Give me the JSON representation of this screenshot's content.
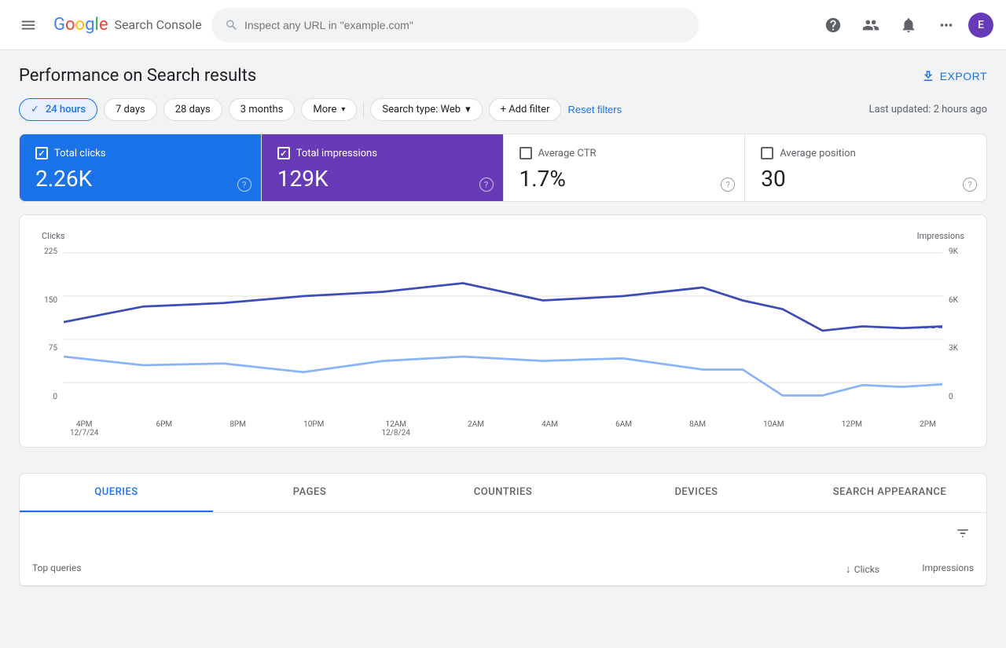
{
  "header": {
    "menu_icon": "menu",
    "logo": {
      "google": "Google",
      "product": "Search Console"
    },
    "search_placeholder": "Inspect any URL in \"example.com\"",
    "icons": [
      "help",
      "people",
      "bell",
      "grid"
    ],
    "avatar_letter": "E"
  },
  "page": {
    "title": "Performance on Search results",
    "export_label": "EXPORT"
  },
  "filters": {
    "time_filters": [
      {
        "label": "24 hours",
        "active": true
      },
      {
        "label": "7 days",
        "active": false
      },
      {
        "label": "28 days",
        "active": false
      },
      {
        "label": "3 months",
        "active": false
      },
      {
        "label": "More",
        "active": false,
        "has_arrow": true
      }
    ],
    "search_type": "Search type: Web",
    "add_filter": "+ Add filter",
    "reset": "Reset filters",
    "last_updated": "Last updated: 2 hours ago"
  },
  "metrics": [
    {
      "id": "total-clicks",
      "label": "Total clicks",
      "value": "2.26K",
      "checked": true,
      "style": "active-blue"
    },
    {
      "id": "total-impressions",
      "label": "Total impressions",
      "value": "129K",
      "checked": true,
      "style": "active-purple"
    },
    {
      "id": "avg-ctr",
      "label": "Average CTR",
      "value": "1.7%",
      "checked": false,
      "style": ""
    },
    {
      "id": "avg-position",
      "label": "Average position",
      "value": "30",
      "checked": false,
      "style": ""
    }
  ],
  "chart": {
    "y_label_left": "Clicks",
    "y_label_right": "Impressions",
    "y_ticks_left": [
      "225",
      "150",
      "75",
      "0"
    ],
    "y_ticks_right": [
      "9K",
      "6K",
      "3K",
      "0"
    ],
    "x_labels": [
      {
        "main": "4PM",
        "sub": "12/7/24"
      },
      {
        "main": "6PM",
        "sub": ""
      },
      {
        "main": "8PM",
        "sub": ""
      },
      {
        "main": "10PM",
        "sub": ""
      },
      {
        "main": "12AM",
        "sub": "12/8/24"
      },
      {
        "main": "2AM",
        "sub": ""
      },
      {
        "main": "4AM",
        "sub": ""
      },
      {
        "main": "6AM",
        "sub": ""
      },
      {
        "main": "8AM",
        "sub": ""
      },
      {
        "main": "10AM",
        "sub": ""
      },
      {
        "main": "12PM",
        "sub": ""
      },
      {
        "main": "2PM",
        "sub": ""
      }
    ]
  },
  "tabs": {
    "items": [
      {
        "label": "QUERIES",
        "active": true
      },
      {
        "label": "PAGES",
        "active": false
      },
      {
        "label": "COUNTRIES",
        "active": false
      },
      {
        "label": "DEVICES",
        "active": false
      },
      {
        "label": "SEARCH APPEARANCE",
        "active": false
      }
    ],
    "table_headers": {
      "queries": "Top queries",
      "clicks": "Clicks",
      "impressions": "Impressions"
    }
  }
}
